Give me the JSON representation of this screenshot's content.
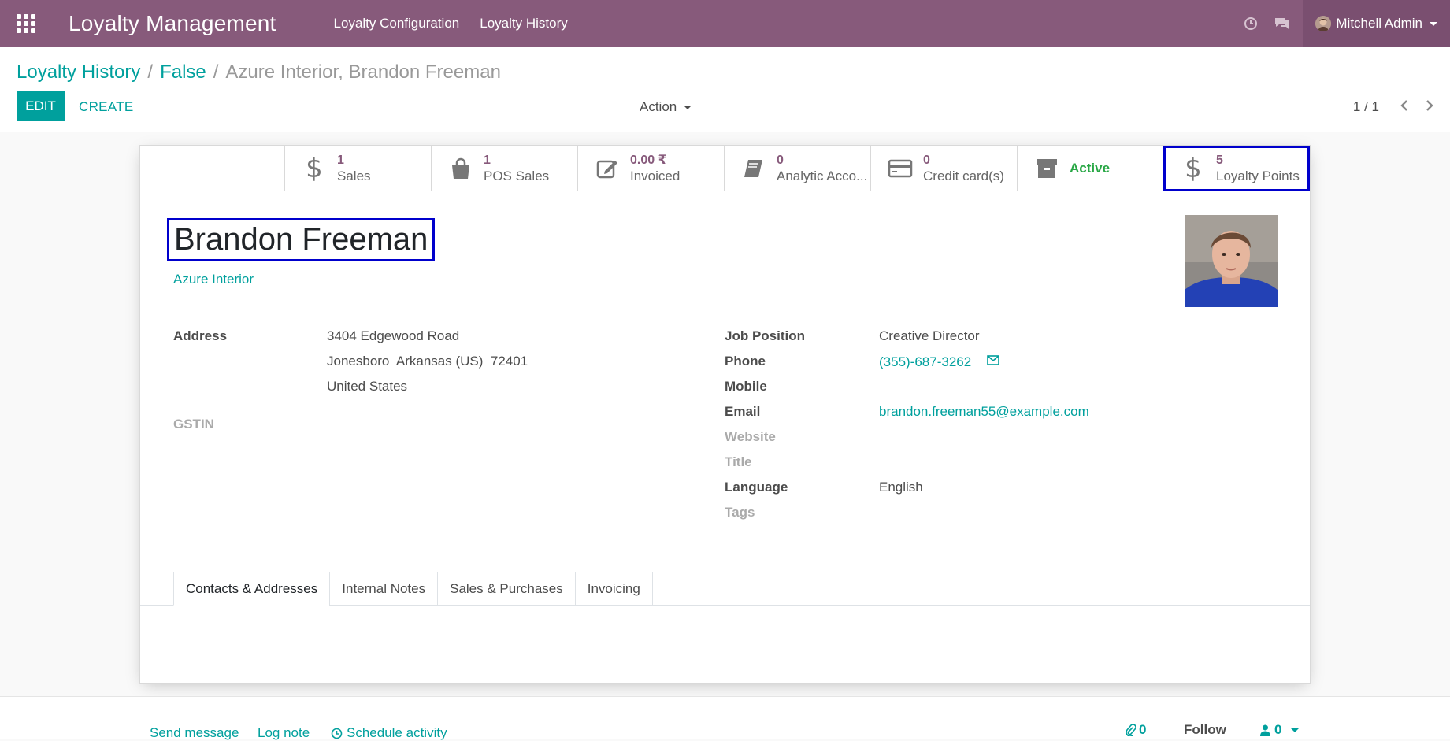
{
  "navbar": {
    "app_title": "Loyalty Management",
    "menu": [
      "Loyalty Configuration",
      "Loyalty History"
    ],
    "user_name": "Mitchell Admin",
    "bg_color": "#875a7b"
  },
  "breadcrumb": {
    "items": [
      "Loyalty History",
      "False"
    ],
    "current": "Azure Interior, Brandon Freeman"
  },
  "control": {
    "edit_label": "EDIT",
    "create_label": "CREATE",
    "action_label": "Action",
    "pager": "1 / 1"
  },
  "stat_buttons": [
    {
      "value": "1",
      "label": "Sales",
      "icon": "dollar-icon"
    },
    {
      "value": "1",
      "label": "POS Sales",
      "icon": "shopping-bag-icon"
    },
    {
      "value": "0.00 ₹",
      "label": "Invoiced",
      "icon": "pencil-square-icon"
    },
    {
      "value": "0",
      "label": "Analytic Acco...",
      "icon": "book-icon"
    },
    {
      "value": "0",
      "label": "Credit card(s)",
      "icon": "credit-card-icon"
    },
    {
      "value": "",
      "label": "Active",
      "icon": "archive-icon"
    },
    {
      "value": "5",
      "label": "Loyalty Points",
      "icon": "dollar-icon"
    }
  ],
  "partner": {
    "name": "Brandon Freeman",
    "company": "Azure Interior"
  },
  "left_fields": {
    "address_label": "Address",
    "address_line1": "3404 Edgewood Road",
    "address_line2": "Jonesboro  Arkansas (US)  72401",
    "address_line3": "United States",
    "gstin_label": "GSTIN"
  },
  "right_fields": {
    "job_label": "Job Position",
    "job_value": "Creative Director",
    "phone_label": "Phone",
    "phone_value": "(355)-687-3262",
    "mobile_label": "Mobile",
    "email_label": "Email",
    "email_value": "brandon.freeman55@example.com",
    "website_label": "Website",
    "title_label": "Title",
    "language_label": "Language",
    "language_value": "English",
    "tags_label": "Tags"
  },
  "tabs": [
    "Contacts & Addresses",
    "Internal Notes",
    "Sales & Purchases",
    "Invoicing"
  ],
  "chatter": {
    "send_message": "Send message",
    "log_note": "Log note",
    "schedule_activity": "Schedule activity",
    "attachments_count": "0",
    "follow": "Follow",
    "followers_count": "0"
  }
}
